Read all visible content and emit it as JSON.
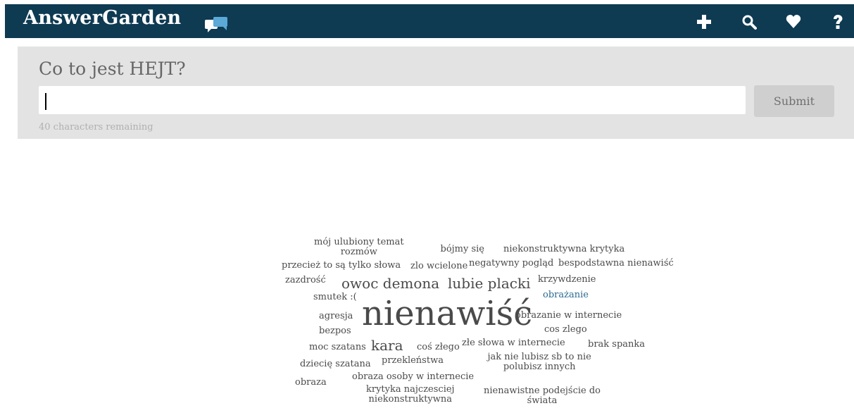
{
  "app": {
    "name": "AnswerGarden",
    "colors": {
      "topbar": "#0e3a52",
      "highlight": "#2a6a91",
      "word": "#4a4a4a"
    }
  },
  "nav": {
    "icons": [
      "plus-icon",
      "search-icon",
      "heart-icon",
      "help-icon"
    ]
  },
  "question": {
    "title": "Co to jest HEJT?",
    "input_value": "",
    "submit_label": "Submit",
    "remaining_text": "40 characters remaining"
  },
  "cloud": {
    "words": [
      {
        "text": "mój ulubiony temat\nrozmów",
        "weight": 1
      },
      {
        "text": "bójmy się",
        "weight": 1
      },
      {
        "text": "niekonstruktywna krytyka",
        "weight": 1
      },
      {
        "text": "przecież to są tylko słowa",
        "weight": 1
      },
      {
        "text": "zlo wcielone",
        "weight": 1
      },
      {
        "text": "negatywny pogląd",
        "weight": 1
      },
      {
        "text": "bespodstawna nienawiść",
        "weight": 1
      },
      {
        "text": "zazdrość",
        "weight": 1
      },
      {
        "text": "owoc demona",
        "weight": 2
      },
      {
        "text": "lubie placki",
        "weight": 2
      },
      {
        "text": "krzywdzenie",
        "weight": 1
      },
      {
        "text": "smutek :(",
        "weight": 1
      },
      {
        "text": "obrażanie",
        "weight": 1,
        "highlight": true
      },
      {
        "text": "agresja",
        "weight": 1
      },
      {
        "text": "nienawiść",
        "weight": 5
      },
      {
        "text": "obrazanie w internecie",
        "weight": 1
      },
      {
        "text": "bezpos",
        "weight": 1
      },
      {
        "text": "cos zlego",
        "weight": 1
      },
      {
        "text": "moc szatans",
        "weight": 1
      },
      {
        "text": "kara",
        "weight": 2
      },
      {
        "text": "coś złego",
        "weight": 1
      },
      {
        "text": "złe słowa w internecie",
        "weight": 1
      },
      {
        "text": "brak spanka",
        "weight": 1
      },
      {
        "text": "dziecię szatana",
        "weight": 1
      },
      {
        "text": "przekleństwa",
        "weight": 1
      },
      {
        "text": "jak nie lubisz sb to nie\npolubisz innych",
        "weight": 1
      },
      {
        "text": "obraza",
        "weight": 1
      },
      {
        "text": "obraza osoby w internecie",
        "weight": 1
      },
      {
        "text": "krytyka najczesciej\nniekonstruktywna",
        "weight": 1
      },
      {
        "text": "nienawistne podejście do\nświata",
        "weight": 1
      }
    ]
  }
}
